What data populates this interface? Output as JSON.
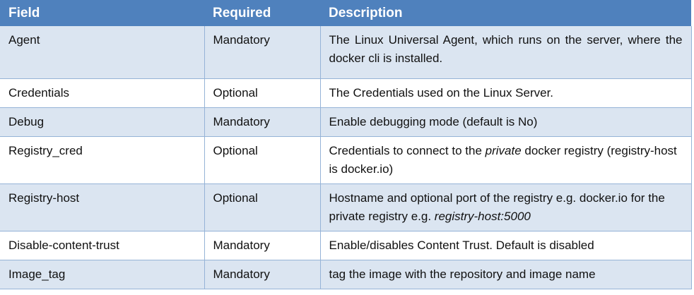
{
  "table": {
    "headers": {
      "field": "Field",
      "required": "Required",
      "description": "Description"
    },
    "rows": [
      {
        "field": "Agent",
        "required": "Mandatory",
        "description": "The Linux Universal Agent, which runs on the server, where the docker cli is installed."
      },
      {
        "field": "Credentials",
        "required": "Optional",
        "description": "The Credentials used on the Linux Server."
      },
      {
        "field": "Debug",
        "required": "Mandatory",
        "description": "Enable debugging mode (default is No)"
      },
      {
        "field": "Registry_cred",
        "required": "Optional",
        "description_parts": {
          "before": "Credentials to connect to the ",
          "italic": "private",
          "after": " docker registry (registry-host is docker.io)"
        }
      },
      {
        "field": "Registry-host",
        "required": "Optional",
        "description_parts": {
          "before": "Hostname and optional port of the registry e.g. docker.io for the private registry e.g. ",
          "italic": "registry-host:5000",
          "after": ""
        }
      },
      {
        "field": "Disable-content-trust",
        "required": "Mandatory",
        "description": "Enable/disables Content Trust. Default is disabled"
      },
      {
        "field": "Image_tag",
        "required": "Mandatory",
        "description": "tag the image with the repository and image name"
      }
    ]
  },
  "colors": {
    "header_bg": "#4f81bd",
    "header_text": "#ffffff",
    "band_bg": "#dbe5f1",
    "border": "#95b3d7"
  }
}
